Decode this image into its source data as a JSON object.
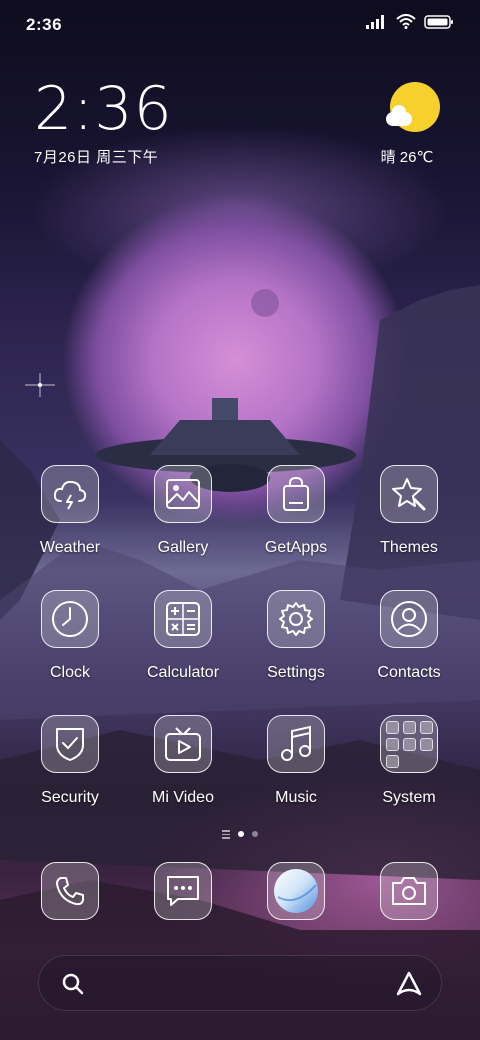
{
  "status_bar": {
    "time": "2:36",
    "icons": [
      "signal-icon",
      "wifi-icon",
      "battery-icon"
    ]
  },
  "clock_widget": {
    "time": "2:36",
    "date": "7月26日 周三下午"
  },
  "weather_widget": {
    "condition_icon": "sun-cloud-icon",
    "text": "晴 26℃"
  },
  "apps": [
    {
      "label": "Weather",
      "icon": "cloud-lightning-icon"
    },
    {
      "label": "Gallery",
      "icon": "image-icon"
    },
    {
      "label": "GetApps",
      "icon": "shopping-bag-icon"
    },
    {
      "label": "Themes",
      "icon": "star-brush-icon"
    },
    {
      "label": "Clock",
      "icon": "clock-icon"
    },
    {
      "label": "Calculator",
      "icon": "calculator-icon"
    },
    {
      "label": "Settings",
      "icon": "gear-icon"
    },
    {
      "label": "Contacts",
      "icon": "person-icon"
    },
    {
      "label": "Security",
      "icon": "shield-check-icon"
    },
    {
      "label": "Mi Video",
      "icon": "tv-play-icon"
    },
    {
      "label": "Music",
      "icon": "music-note-icon"
    },
    {
      "label": "System",
      "icon": "folder-icon"
    }
  ],
  "dock": [
    {
      "name": "phone",
      "icon": "phone-icon"
    },
    {
      "name": "messages",
      "icon": "message-icon"
    },
    {
      "name": "browser",
      "icon": "browser-icon"
    },
    {
      "name": "camera",
      "icon": "camera-icon"
    }
  ],
  "pager": {
    "pages": 2,
    "active": 1
  },
  "search_bar": {
    "left_icon": "search-icon",
    "right_icon": "assistant-icon"
  },
  "colors": {
    "sun": "#f6d12e",
    "planet": "#c784cf",
    "tile_border": "#ffffff"
  }
}
